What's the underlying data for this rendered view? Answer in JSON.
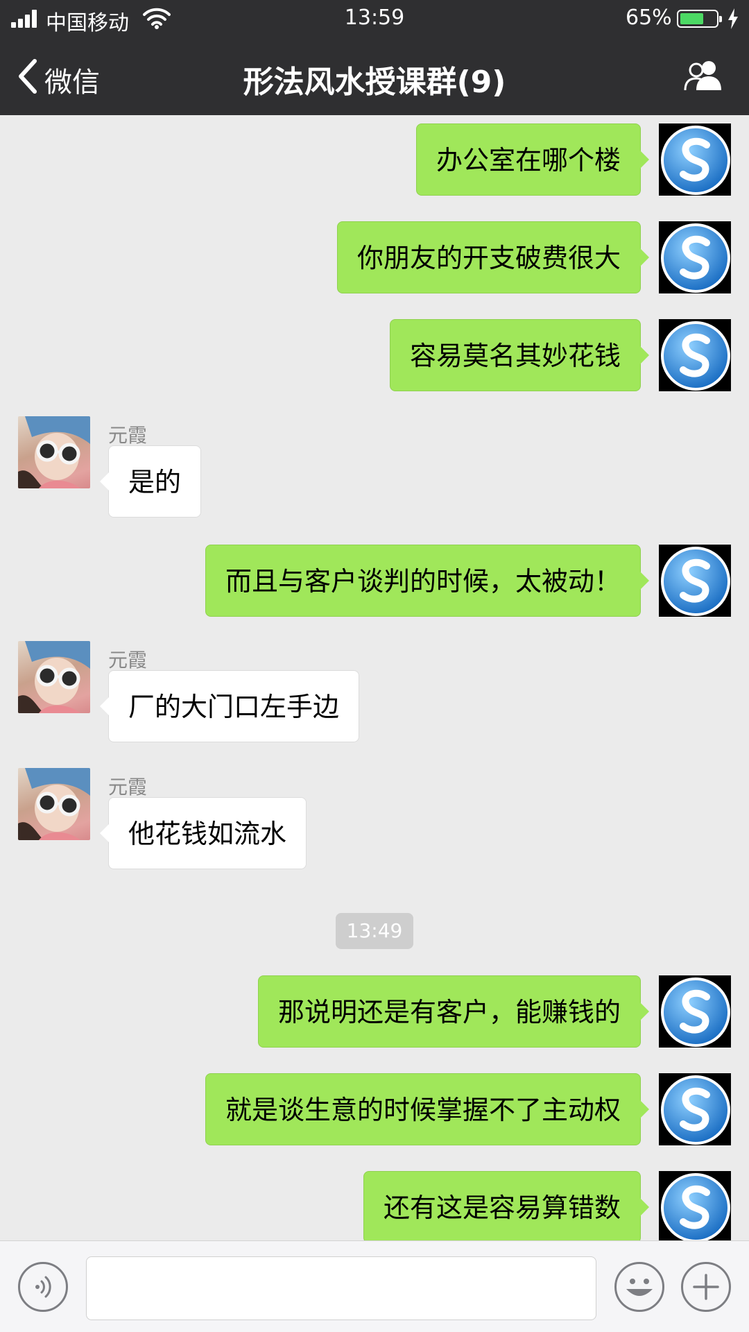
{
  "status_bar": {
    "carrier": "中国移动",
    "time": "13:59",
    "battery_percent": "65%",
    "battery_level": 0.65
  },
  "nav": {
    "back_label": "微信",
    "title": "形法风水授课群(9)",
    "members_icon": "group-members-icon"
  },
  "messages": [
    {
      "side": "out",
      "text": "办公室在哪个楼"
    },
    {
      "side": "out",
      "text": "你朋友的开支破费很大"
    },
    {
      "side": "out",
      "text": "容易莫名其妙花钱"
    },
    {
      "side": "in",
      "sender": "元霞",
      "text": "是的"
    },
    {
      "side": "out",
      "text": "而且与客户谈判的时候，太被动！"
    },
    {
      "side": "in",
      "sender": "元霞",
      "text": "厂的大门口左手边"
    },
    {
      "side": "in",
      "sender": "元霞",
      "text": "他花钱如流水"
    },
    {
      "timestamp": "13:49"
    },
    {
      "side": "out",
      "text": "那说明还是有客户，能赚钱的"
    },
    {
      "side": "out",
      "text": "就是谈生意的时候掌握不了主动权"
    },
    {
      "side": "out",
      "text": "还有这是容易算错数"
    }
  ],
  "input_bar": {
    "voice_icon": "voice-input-icon",
    "message_value": "",
    "emoji_icon": "emoji-icon",
    "more_icon": "plus-icon"
  },
  "colors": {
    "nav_background": "#2f2f31",
    "chat_background": "#ebebeb",
    "outgoing_bubble": "#a0e75a",
    "incoming_bubble": "#ffffff",
    "battery_fill": "#4cd964"
  }
}
